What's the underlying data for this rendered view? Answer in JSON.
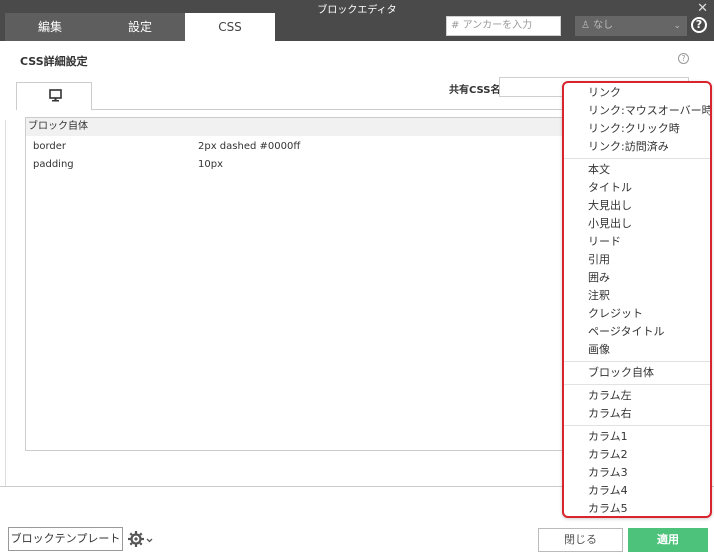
{
  "window": {
    "title": "ブロックエディタ",
    "close_glyph": "✕"
  },
  "tabs": [
    {
      "label": "編集"
    },
    {
      "label": "設定"
    },
    {
      "label": "CSS"
    }
  ],
  "anchor": {
    "prefix": "#",
    "placeholder": "アンカーを入力"
  },
  "select": {
    "value": "なし"
  },
  "help_glyph": "?",
  "css_panel": {
    "title": "CSS詳細設定",
    "shared_css_label": "共有CSS名",
    "shared_css_value": "",
    "group_header": "ブロック自体",
    "properties": [
      {
        "name": "border",
        "value": "2px dashed #0000ff"
      },
      {
        "name": "padding",
        "value": "10px"
      }
    ]
  },
  "dropdown": {
    "groups": [
      [
        "リンク",
        "リンク:マウスオーバー時",
        "リンク:クリック時",
        "リンク:訪問済み"
      ],
      [
        "本文",
        "タイトル",
        "大見出し",
        "小見出し",
        "リード",
        "引用",
        "囲み",
        "注釈",
        "クレジット",
        "ページタイトル",
        "画像"
      ],
      [
        "ブロック自体"
      ],
      [
        "カラム左",
        "カラム右"
      ],
      [
        "カラム1",
        "カラム2",
        "カラム3",
        "カラム4",
        "カラム5"
      ]
    ]
  },
  "footer": {
    "template_button": "ブロックテンプレート",
    "close_button": "閉じる",
    "apply_button": "適用"
  },
  "colors": {
    "accent_green": "#4cc27a",
    "highlight_red": "#d9232d",
    "dark_bar": "#4a4a4a"
  },
  "icons": [
    "desktop-icon",
    "gear-icon",
    "help-icon",
    "close-icon",
    "chevron-down-icon",
    "user-icon"
  ]
}
